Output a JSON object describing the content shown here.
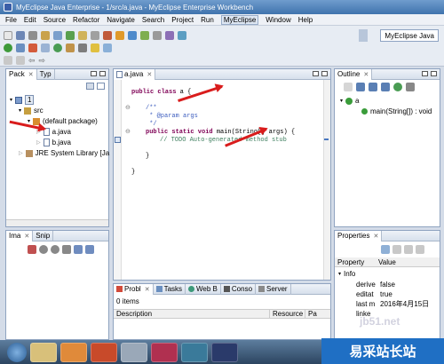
{
  "window": {
    "title": "MyEclipse Java Enterprise - 1/src/a.java - MyEclipse Enterprise Workbench"
  },
  "menu": [
    "File",
    "Edit",
    "Source",
    "Refactor",
    "Navigate",
    "Search",
    "Project",
    "Run",
    "MyEclipse",
    "Window",
    "Help"
  ],
  "perspective": {
    "label": "MyEclipse Java"
  },
  "package_explorer": {
    "tabs": [
      "Pack",
      "Typ"
    ],
    "tree": [
      {
        "label": "1"
      },
      {
        "label": "src"
      },
      {
        "label": "(default package)"
      },
      {
        "label": "a.java"
      },
      {
        "label": "b.java"
      },
      {
        "label": "JRE System Library [Ja"
      }
    ]
  },
  "editor": {
    "tab": "a.java",
    "lines": {
      "l1_kw": "public class ",
      "l1_rest": "a {",
      "l2": "/**",
      "l3": " * @param args",
      "l4": " */",
      "l5_kw": "public static void ",
      "l5_rest": "main(String[] args) {",
      "l6": "// TODO Auto-generated method stub",
      "l7": "}",
      "l8": "}"
    }
  },
  "outline": {
    "tab": "Outline",
    "items": [
      "a",
      "main(String[]) : void"
    ]
  },
  "hierarchy_panel": {
    "tabs": [
      "Ima",
      "Snip"
    ]
  },
  "bottom_panel": {
    "tabs": [
      "Probl",
      "Tasks",
      "Web B",
      "Conso",
      "Server"
    ],
    "count": "0 items",
    "columns": [
      "Description",
      "Resource",
      "Pa"
    ]
  },
  "properties": {
    "tab": "Properties",
    "headers": [
      "Property",
      "Value"
    ],
    "group": "Info",
    "rows": [
      {
        "name": "derive",
        "value": "false"
      },
      {
        "name": "editat",
        "value": "true"
      },
      {
        "name": "last m",
        "value": "2016年4月15日"
      },
      {
        "name": "linke",
        "value": ""
      }
    ]
  },
  "watermark": {
    "text": "易采站长站",
    "url": "jb51.net"
  },
  "colors": {
    "title": "#3f73ad",
    "keyword": "#7f0055",
    "comment": "#3f7f5f",
    "javadoc": "#3f5fbf",
    "arrow": "#d91c1c"
  }
}
